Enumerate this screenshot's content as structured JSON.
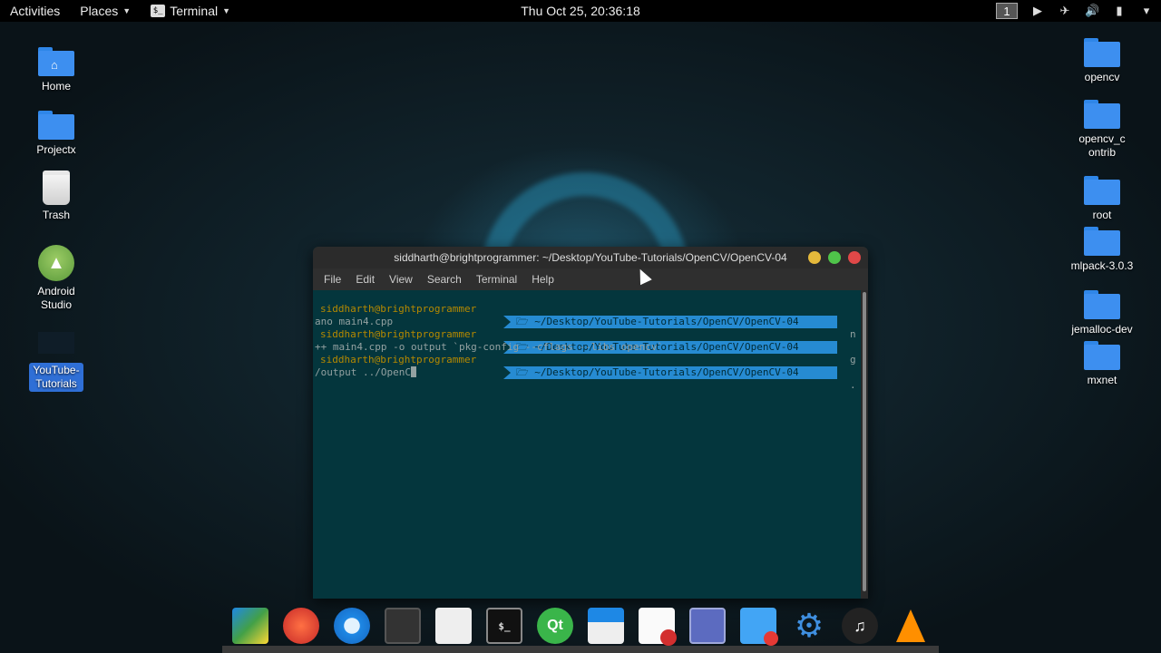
{
  "topbar": {
    "activities": "Activities",
    "places": "Places",
    "terminal": "Terminal",
    "clock": "Thu Oct 25, 20:36:18",
    "workspace": "1"
  },
  "desktop_left": [
    {
      "label": "Home",
      "icon": "home-folder-icon"
    },
    {
      "label": "Projectx",
      "icon": "folder-icon"
    },
    {
      "label": "Trash",
      "icon": "trash-icon"
    },
    {
      "label": "Android Studio",
      "icon": "android-studio-icon"
    },
    {
      "label": "YouTube-Tutorials",
      "icon": "folder-icon"
    }
  ],
  "desktop_right": [
    {
      "label": "opencv"
    },
    {
      "label": "opencv_contrib"
    },
    {
      "label": "root"
    },
    {
      "label": "mlpack-3.0.3"
    },
    {
      "label": "jemalloc-dev"
    },
    {
      "label": "mxnet"
    }
  ],
  "terminal": {
    "title": "siddharth@brightprogrammer: ~/Desktop/YouTube-Tutorials/OpenCV/OpenCV-04",
    "menu": [
      "File",
      "Edit",
      "View",
      "Search",
      "Terminal",
      "Help"
    ],
    "prompt_user": "siddharth@brightprogrammer",
    "prompt_path": "~/Desktop/YouTube-Tutorials/OpenCV/OpenCV-04",
    "lines": [
      {
        "tail": "n",
        "cmd": "ano main4.cpp"
      },
      {
        "tail": "g",
        "cmd": "++ main4.cpp -o output `pkg-config --cflags --libs opencv`"
      },
      {
        "tail": ".",
        "cmd": "/output ../OpenC"
      }
    ]
  },
  "colors": {
    "accent": "#268bd2",
    "terminal_bg": "#04363d",
    "prompt_user": "#b58900"
  }
}
